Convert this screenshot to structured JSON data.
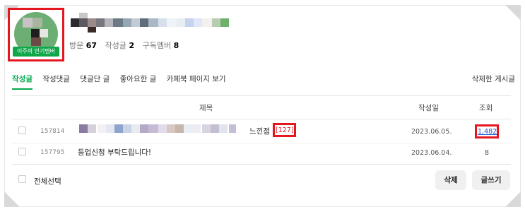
{
  "profile": {
    "badge_label": "이주의 인기멤버",
    "stats": [
      {
        "label": "방문",
        "value": "67"
      },
      {
        "label": "작성글",
        "value": "2"
      },
      {
        "label": "구독멤버",
        "value": "8"
      }
    ]
  },
  "tabs": [
    {
      "label": "작성글",
      "active": true
    },
    {
      "label": "작성댓글",
      "active": false
    },
    {
      "label": "댓글단 글",
      "active": false
    },
    {
      "label": "좋아요한 글",
      "active": false
    },
    {
      "label": "카페북 페이지 보기",
      "active": false
    }
  ],
  "deleted_posts_link": "삭제한 게시글",
  "table": {
    "headers": {
      "title": "제목",
      "date": "작성일",
      "views": "조회"
    },
    "rows": [
      {
        "number": "157814",
        "title_suffix": "느낀점",
        "comment_count": "[127]",
        "date": "2023.06.05.",
        "views": "1,482"
      },
      {
        "number": "157795",
        "title": "등업신청 부탁드립니다!",
        "date": "2023.06.04.",
        "views": "8"
      }
    ]
  },
  "footer": {
    "select_all_label": "전체선택",
    "delete_button": "삭제",
    "write_button": "글쓰기"
  },
  "colors": {
    "accent_green": "#03a94d",
    "highlight_red": "#e4161e",
    "badge_green": "#10a64a"
  }
}
